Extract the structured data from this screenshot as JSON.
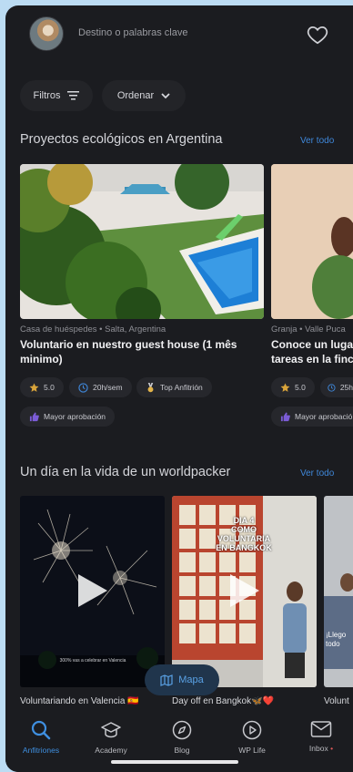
{
  "header": {
    "search_placeholder": "Destino o palabras clave"
  },
  "filters": {
    "filtros_label": "Filtros",
    "ordenar_label": "Ordenar"
  },
  "sections": {
    "eco": {
      "title": "Proyectos ecológicos en Argentina",
      "link": "Ver todo"
    },
    "day": {
      "title": "Un día en la vida de un worldpacker",
      "link": "Ver todo"
    }
  },
  "cards": [
    {
      "meta": "Casa de huéspedes • Salta, Argentina",
      "title_line1": "Voluntario en nuestro guest house (1 mês",
      "title_line2": "minimo)",
      "rating": "5.0",
      "hours": "20h/sem",
      "badge": "Top Anfitrión",
      "approval": "Mayor aprobación"
    },
    {
      "meta": "Granja • Valle Puca",
      "title_line1": "Conoce un luga",
      "title_line2": "tareas en la finc",
      "rating": "5.0",
      "hours": "25h",
      "approval": "Mayor aprobació"
    }
  ],
  "videos": [
    {
      "label": "Voluntariando en Valencia 🇪🇸",
      "caption": "300% vas a celebrar en Valencia"
    },
    {
      "label": "Day off en Bangkok🦋❤️",
      "overlay_line1": "DIA 4",
      "overlay_line2": "COMO VOLUNTARIA",
      "overlay_line3": "EN BANGKOK"
    },
    {
      "label": "Volunt",
      "overlay": "¡Llego todo"
    }
  ],
  "map_button": {
    "label": "Mapa"
  },
  "tabs": [
    {
      "label": "Anfitriones",
      "icon": "search-icon",
      "active": true
    },
    {
      "label": "Academy",
      "icon": "graduation-cap-icon"
    },
    {
      "label": "Blog",
      "icon": "compass-icon"
    },
    {
      "label": "WP Life",
      "icon": "play-circle-icon"
    },
    {
      "label": "Inbox",
      "icon": "mail-icon",
      "dot": "•"
    }
  ],
  "colors": {
    "accent": "#3f87d9",
    "background": "#1b1c20",
    "chip": "#26272c",
    "star": "#d9a43a",
    "inbox_dot": "#e05a5a"
  }
}
